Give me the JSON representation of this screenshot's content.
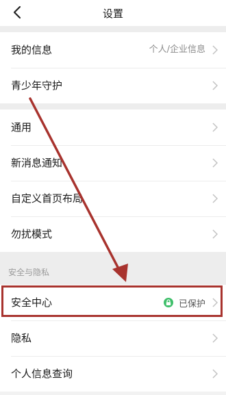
{
  "header": {
    "title": "设置"
  },
  "groups": [
    {
      "items": [
        {
          "label": "我的信息",
          "value": "个人/企业信息"
        },
        {
          "label": "青少年守护"
        }
      ]
    },
    {
      "items": [
        {
          "label": "通用"
        },
        {
          "label": "新消息通知"
        },
        {
          "label": "自定义首页布局"
        },
        {
          "label": "勿扰模式"
        }
      ]
    },
    {
      "caption": "安全与隐私",
      "items": [
        {
          "label": "安全中心",
          "status": "已保护",
          "status_icon": "lock-icon"
        },
        {
          "label": "隐私"
        },
        {
          "label": "个人信息查询"
        }
      ]
    }
  ],
  "colors": {
    "annotation": "#a8332e",
    "status_green": "#3fbf6a"
  }
}
